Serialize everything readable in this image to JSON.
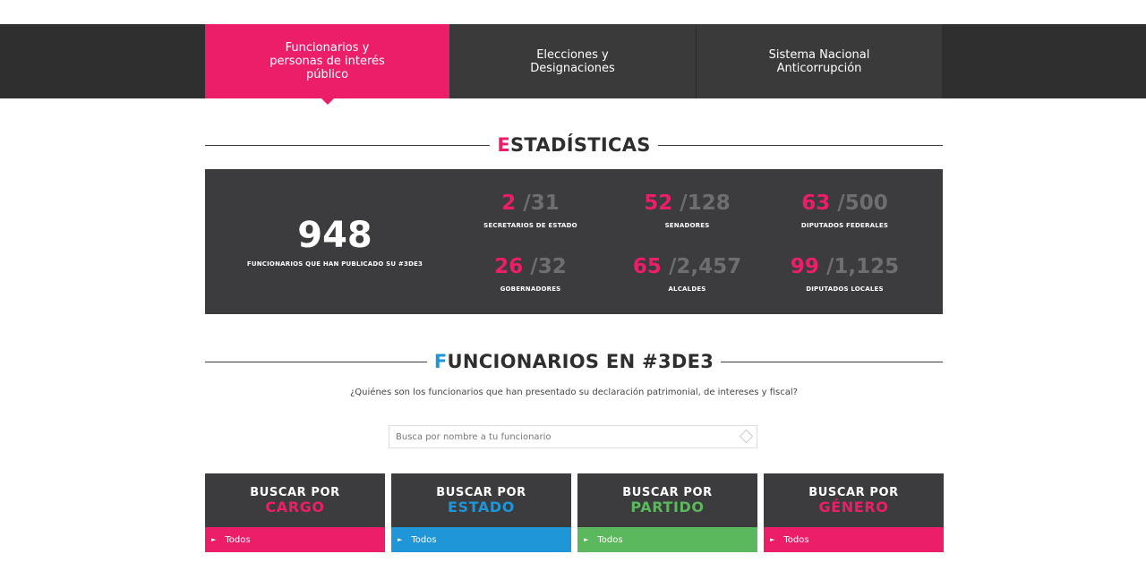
{
  "nav": {
    "tabs": [
      {
        "label": "Funcionarios y\npersonas de interés\npúblico"
      },
      {
        "label": "Elecciones y\nDesignaciones"
      },
      {
        "label": "Sistema Nacional\nAnticorrupción"
      }
    ]
  },
  "stats_section": {
    "title_initial": "E",
    "title_rest": "STADÍSTICAS",
    "main": {
      "value": "948",
      "label": "FUNCIONARIOS QUE HAN PUBLICADO SU #3DE3"
    },
    "items": [
      {
        "have": "2",
        "total": "/31",
        "label": "SECRETARIOS DE ESTADO"
      },
      {
        "have": "52",
        "total": "/128",
        "label": "SENADORES"
      },
      {
        "have": "63",
        "total": "/500",
        "label": "DIPUTADOS FEDERALES"
      },
      {
        "have": "26",
        "total": "/32",
        "label": "GOBERNADORES"
      },
      {
        "have": "65",
        "total": "/2,457",
        "label": "ALCALDES"
      },
      {
        "have": "99",
        "total": "/1,125",
        "label": "DIPUTADOS LOCALES"
      }
    ]
  },
  "officials_section": {
    "title_initial": "F",
    "title_rest": "UNCIONARIOS EN #3DE3",
    "subtitle": "¿Quiénes son los funcionarios que han presentado su declaración patrimonial, de intereses y fiscal?",
    "search_placeholder": "Busca por nombre a tu funcionario"
  },
  "filters": [
    {
      "lead": "BUSCAR POR",
      "category": "CARGO",
      "selected": "Todos",
      "color": "#ed1e69"
    },
    {
      "lead": "BUSCAR POR",
      "category": "ESTADO",
      "selected": "Todos",
      "color": "#1e96d8"
    },
    {
      "lead": "BUSCAR POR",
      "category": "PARTIDO",
      "selected": "Todos",
      "color": "#5cb85c"
    },
    {
      "lead": "BUSCAR POR",
      "category": "GÉNERO",
      "selected": "Todos",
      "color": "#ed1e69"
    }
  ]
}
